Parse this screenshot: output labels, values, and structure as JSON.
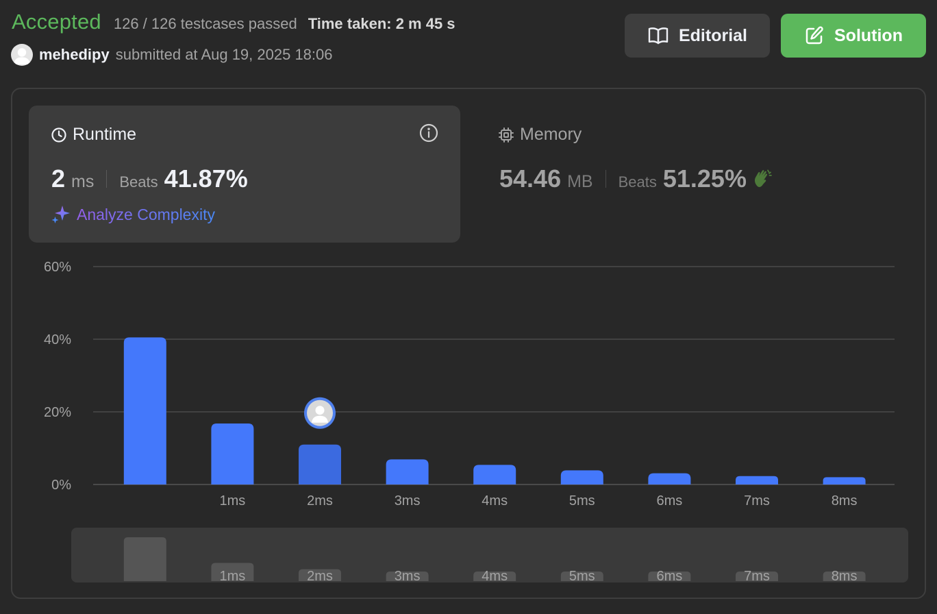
{
  "status": {
    "result": "Accepted",
    "testcases": "126 / 126 testcases passed",
    "time_taken": "Time taken: 2 m 45 s",
    "username": "mehedipy",
    "submitted_at": "submitted at Aug 19, 2025 18:06"
  },
  "buttons": {
    "editorial": "Editorial",
    "solution": "Solution"
  },
  "runtime": {
    "title": "Runtime",
    "value": "2",
    "unit": "ms",
    "beats_label": "Beats",
    "beats_value": "41.87%",
    "analyze_label": "Analyze Complexity"
  },
  "memory": {
    "title": "Memory",
    "value": "54.46",
    "unit": "MB",
    "beats_label": "Beats",
    "beats_value": "51.25%"
  },
  "colors": {
    "accepted": "#5cb85c",
    "bar": "#4478fb",
    "bar_selected": "#3b6ae0",
    "panel_border": "#3e3e3e"
  },
  "chart_data": {
    "type": "bar",
    "ylim": [
      0,
      60
    ],
    "yticks": [
      "60%",
      "40%",
      "20%",
      "0%"
    ],
    "ytick_values": [
      60,
      40,
      20,
      0
    ],
    "categories": [
      "",
      "1ms",
      "2ms",
      "3ms",
      "4ms",
      "5ms",
      "6ms",
      "7ms",
      "8ms"
    ],
    "values": [
      40.5,
      16.8,
      11,
      6.9,
      5.4,
      3.9,
      3.1,
      2.3,
      2.0
    ],
    "selected_category": "2ms",
    "grid": true
  }
}
